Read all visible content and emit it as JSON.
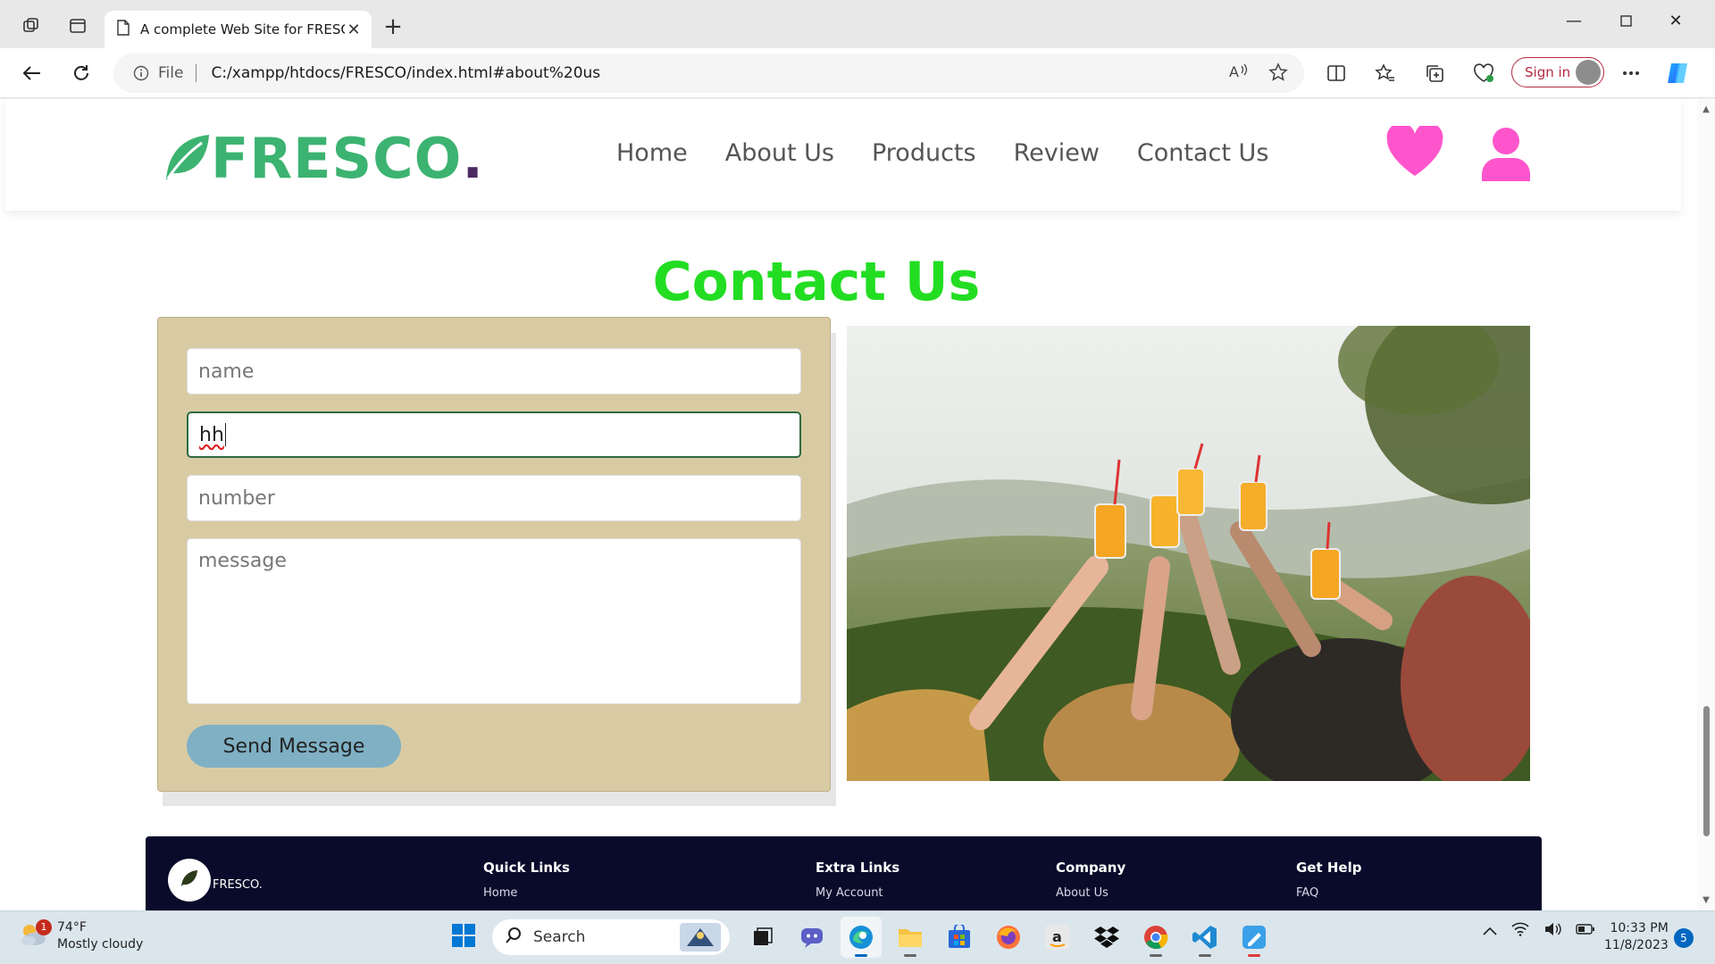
{
  "browser": {
    "tab_title": "A complete Web Site for FRESCO",
    "address_info": "File",
    "url": "C:/xampp/htdocs/FRESCO/index.html#about%20us",
    "signin_label": "Sign in"
  },
  "site": {
    "logo_text": "FRESCO",
    "logo_dot": ".",
    "nav": [
      "Home",
      "About Us",
      "Products",
      "Review",
      "Contact Us"
    ],
    "accent_color": "#3cb371",
    "icon_color": "#ff55cc"
  },
  "contact": {
    "title": "Contact Us",
    "name_placeholder": "name",
    "email_value": "hh",
    "number_placeholder": "number",
    "message_placeholder": "message",
    "send_label": "Send Message"
  },
  "footer": {
    "brand": "FRESCO.",
    "columns": [
      {
        "heading": "Quick Links",
        "first_link": "Home"
      },
      {
        "heading": "Extra Links",
        "first_link": "My Account"
      },
      {
        "heading": "Company",
        "first_link": "About Us"
      },
      {
        "heading": "Get Help",
        "first_link": "FAQ"
      }
    ]
  },
  "taskbar": {
    "weather_badge": "1",
    "temperature": "74°F",
    "condition": "Mostly cloudy",
    "search_label": "Search",
    "time": "10:33 PM",
    "date": "11/8/2023",
    "notification_count": "5"
  }
}
